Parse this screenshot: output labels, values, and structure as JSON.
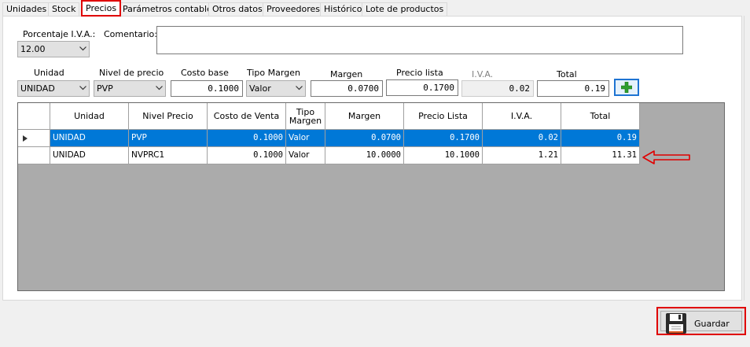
{
  "tabs": [
    "Unidades",
    "Stock",
    "Precios",
    "Parámetros contables",
    "Otros datos",
    "Proveedores",
    "Histórico",
    "Lote de productos"
  ],
  "active_tab": "Precios",
  "form": {
    "iva_label": "Porcentaje I.V.A.:",
    "iva_value": "12.00",
    "comment_label": "Comentario:",
    "comment_value": "",
    "unidad_label": "Unidad",
    "unidad_value": "UNIDAD",
    "nivel_label": "Nivel de precio",
    "nivel_value": "PVP",
    "costo_label": "Costo base",
    "costo_value": "0.1000",
    "tipo_label": "Tipo Margen",
    "tipo_value": "Valor",
    "margen_label": "Margen",
    "margen_value": "0.0700",
    "precio_label": "Precio lista",
    "precio_value": "0.1700",
    "iva2_label": "I.V.A.",
    "iva2_value": "0.02",
    "total_label": "Total",
    "total_value": "0.19",
    "add_icon": "plus-icon"
  },
  "table": {
    "headers": [
      "Unidad",
      "Nivel Precio",
      "Costo de Venta",
      "Tipo Margen",
      "Margen",
      "Precio Lista",
      "I.V.A.",
      "Total"
    ],
    "rows": [
      [
        "UNIDAD",
        "PVP",
        "0.1000",
        "Valor",
        "0.0700",
        "0.1700",
        "0.02",
        "0.19"
      ],
      [
        "UNIDAD",
        "NVPRC1",
        "0.1000",
        "Valor",
        "10.0000",
        "10.1000",
        "1.21",
        "11.31"
      ]
    ],
    "selected_row": 0
  },
  "save_button": {
    "label": "Guardar",
    "icon": "floppy-disk-icon"
  },
  "colors": {
    "highlight_red": "#e00000",
    "selection_blue": "#0078d7",
    "add_green": "#2e9e2e"
  }
}
